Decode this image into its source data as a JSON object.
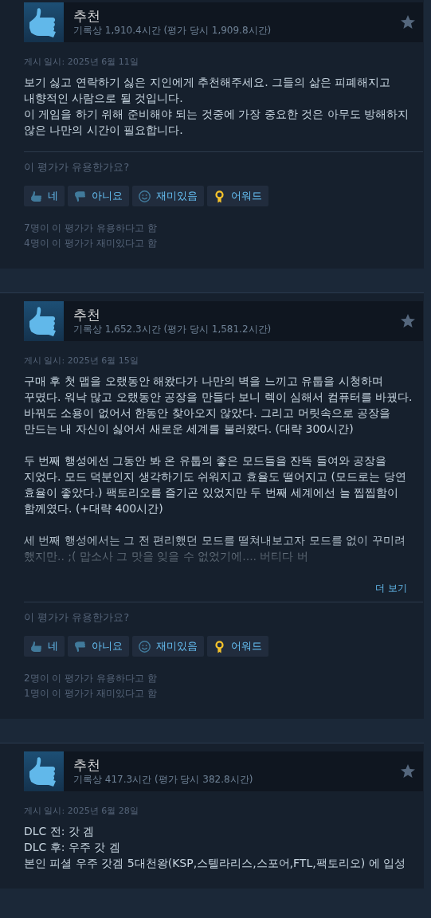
{
  "reviews": [
    {
      "verdict": "추천",
      "hours": "기록상 1,910.4시간 (평가 당시 1,909.8시간)",
      "posted": "게시 일시: 2025년 6월 11일",
      "body": "보기 싫고 연락하기 싫은 지인에게 추천해주세요. 그들의 삶은 피폐해지고 내향적인 사람으로 될 것입니다.\n이 게임을 하기 위해 준비해야 되는 것중에 가장 중요한 것은 아무도 방해하지 않은 나만의 시간이 필요합니다.",
      "prompt": "이 평가가 유용한가요?",
      "buttons": [
        {
          "kind": "yes",
          "label": "네"
        },
        {
          "kind": "no",
          "label": "아니요"
        },
        {
          "kind": "funny",
          "label": "재미있음"
        },
        {
          "kind": "award",
          "label": "어워드"
        }
      ],
      "counts": [
        "7명이 이 평가가 유용하다고 함",
        "4명이 이 평가가 재미있다고 함"
      ]
    },
    {
      "verdict": "추천",
      "hours": "기록상 1,652.3시간 (평가 당시 1,581.2시간)",
      "posted": "게시 일시: 2025년 6월 15일",
      "body": "구매 후 첫 맵을 오랬동안 해왔다가 나만의 벽을 느끼고 유툽을 시청하며 꾸몄다. 워낙 많고 오랬동안 공장을 만들다 보니 렉이 심해서 컴퓨터를 바꿨다. 바꿔도 소용이 없어서 한동안 찾아오지 않았다. 그리고 머릿속으로 공장을 만드는 내 자신이 싫어서 새로운 세계를 불러왔다. (대략 300시간)\n\n두 번째 행성에선 그동안 봐 온 유툽의 좋은 모드들을 잔뜩 들여와 공장을 지었다. 모드 덕분인지 생각하기도 쉬워지고 효율도 떨어지고 (모드로는 당연 효율이 좋았다.) 팩토리오를 즐기곤 있었지만 두 번째 세계에선 늘 찝찝함이 함께였다. (+대략 400시간)\n\n세 번째 행성에서는 그 전 편리했던 모드를 떨쳐내보고자 모드를 없이 꾸미려 했지만.. ;( 맙소사 그 맛을 잊을 수 없었기에.... 버티다 버",
      "more": "더 보기",
      "prompt": "이 평가가 유용한가요?",
      "buttons": [
        {
          "kind": "yes",
          "label": "네"
        },
        {
          "kind": "no",
          "label": "아니요"
        },
        {
          "kind": "funny",
          "label": "재미있음"
        },
        {
          "kind": "award",
          "label": "어워드"
        }
      ],
      "counts": [
        "2명이 이 평가가 유용하다고 함",
        "1명이 이 평가가 재미있다고 함"
      ]
    },
    {
      "verdict": "추천",
      "hours": "기록상 417.3시간 (평가 당시 382.8시간)",
      "posted": "게시 일시: 2025년 6월 28일",
      "body": "DLC 전: 갓 겜\nDLC 후: 우주 갓 겜\n본인 피셜 우주 갓겜 5대천왕(KSP,스텔라리스,스포어,FTL,팩토리오) 에 입성"
    }
  ]
}
